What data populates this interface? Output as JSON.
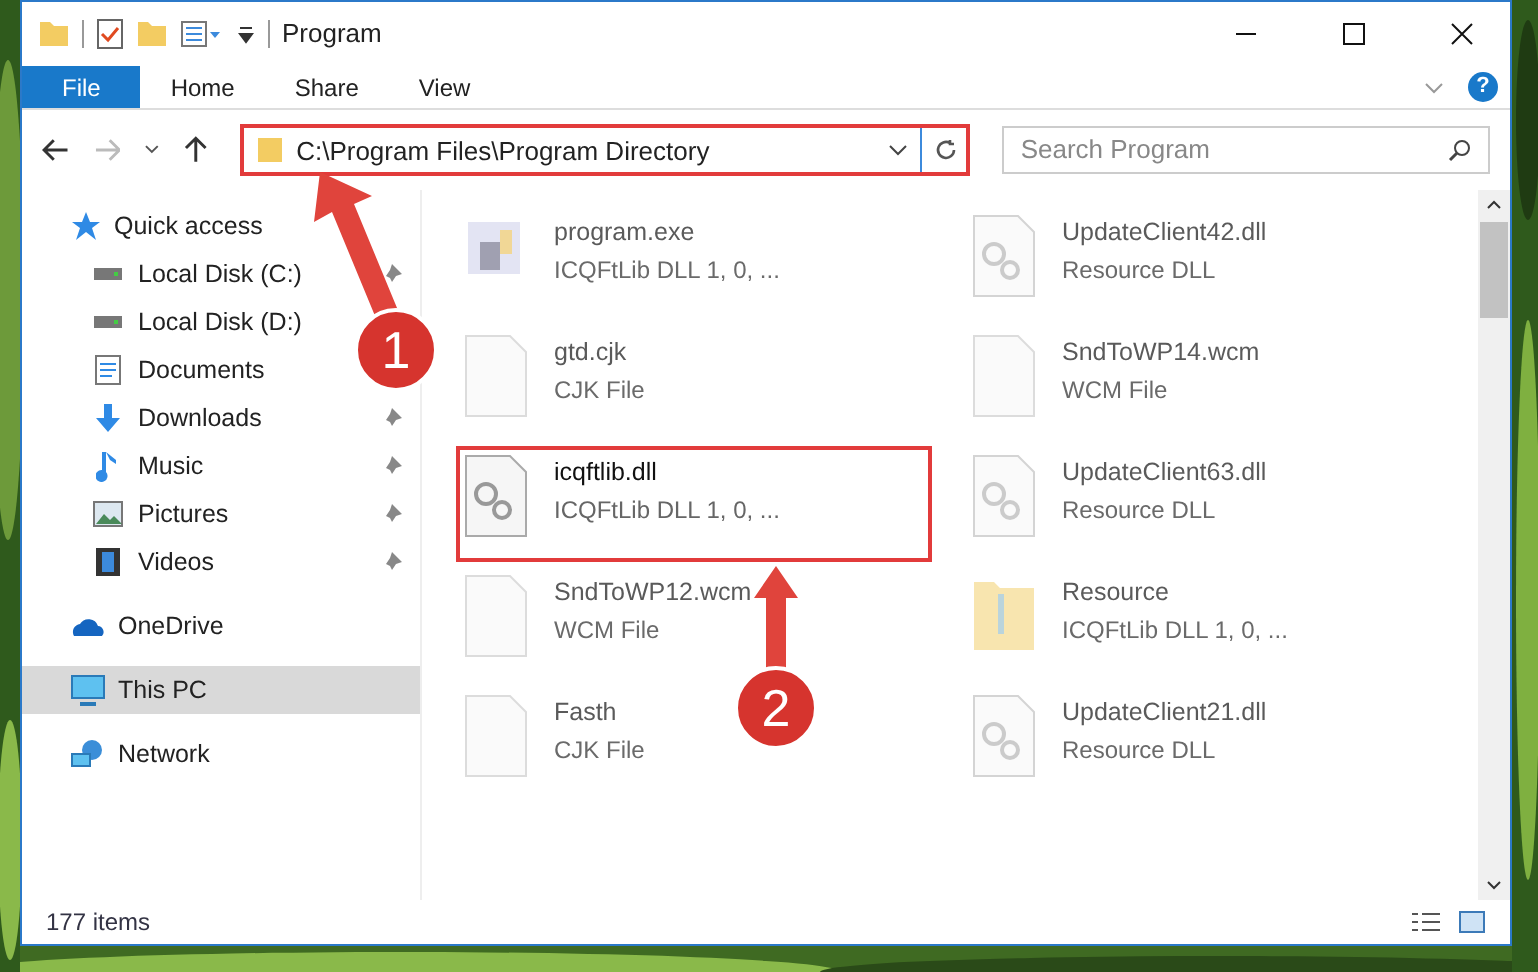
{
  "window": {
    "title": "Program"
  },
  "ribbon_tabs": [
    {
      "label": "File",
      "selected": true
    },
    {
      "label": "Home",
      "selected": false
    },
    {
      "label": "Share",
      "selected": false
    },
    {
      "label": "View",
      "selected": false
    }
  ],
  "help_button": {
    "label": "?"
  },
  "address": {
    "path": "C:\\Program Files\\Program Directory"
  },
  "search": {
    "placeholder": "Search Program"
  },
  "sidebar": {
    "items": [
      {
        "label": "Quick access",
        "kind": "star",
        "selected": false,
        "children": [
          {
            "label": "Local Disk (C:)",
            "kind": "disk",
            "pinned": true,
            "selected": false
          },
          {
            "label": "Local Disk (D:)",
            "kind": "disk",
            "selected": false
          },
          {
            "label": "Documents",
            "kind": "doc",
            "selected": false
          },
          {
            "label": "Downloads",
            "kind": "down",
            "pinned": true,
            "selected": false
          },
          {
            "label": "Music",
            "kind": "music",
            "pinned": true,
            "selected": false
          },
          {
            "label": "Pictures",
            "kind": "pictures",
            "pinned": true,
            "selected": false
          },
          {
            "label": "Videos",
            "kind": "videos",
            "pinned": true,
            "selected": false
          }
        ]
      },
      {
        "label": "OneDrive",
        "kind": "cloud",
        "selected": false
      },
      {
        "label": "This PC",
        "kind": "pc",
        "selected": true
      },
      {
        "label": "Network",
        "kind": "network",
        "selected": false
      }
    ]
  },
  "files": [
    {
      "name": "program.exe",
      "type": "ICQFtLib DLL 1, 0, ...",
      "kind": "exe",
      "dimmed": true
    },
    {
      "name": "UpdateClient42.dll",
      "type": "Resource DLL",
      "kind": "dll",
      "dimmed": true
    },
    {
      "name": "gtd.cjk",
      "type": "CJK File",
      "kind": "blank",
      "dimmed": true
    },
    {
      "name": "SndToWP14.wcm",
      "type": "WCM File",
      "kind": "blank",
      "dimmed": true
    },
    {
      "name": "icqftlib.dll",
      "type": "ICQFtLib DLL 1, 0, ...",
      "kind": "dll",
      "dimmed": false
    },
    {
      "name": "UpdateClient63.dll",
      "type": "Resource DLL",
      "kind": "dll",
      "dimmed": true
    },
    {
      "name": "SndToWP12.wcm",
      "type": "WCM File",
      "kind": "blank",
      "dimmed": true
    },
    {
      "name": "Resource",
      "type": "ICQFtLib DLL 1, 0, ...",
      "kind": "folder",
      "dimmed": true
    },
    {
      "name": "Fasth",
      "type": "CJK File",
      "kind": "blank",
      "dimmed": true
    },
    {
      "name": "UpdateClient21.dll",
      "type": "Resource DLL",
      "kind": "dll",
      "dimmed": true
    }
  ],
  "status_bar": {
    "count": "177 items"
  },
  "annotations": [
    {
      "label": "1"
    },
    {
      "label": "2"
    }
  ]
}
